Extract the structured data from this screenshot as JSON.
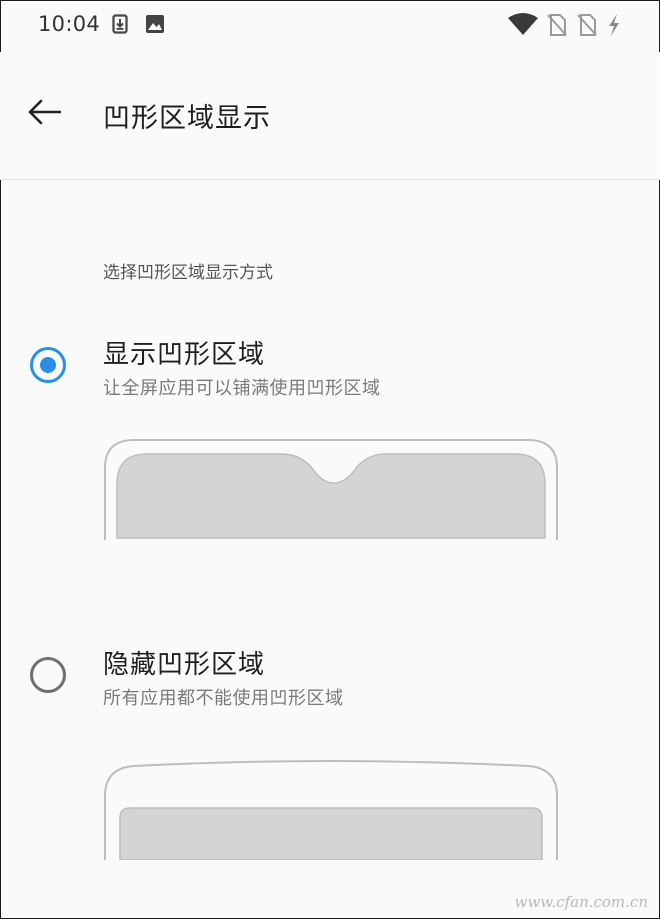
{
  "status_bar": {
    "time": "10:04",
    "left_icons": [
      "download-icon",
      "image-icon"
    ],
    "right_icons": [
      "wifi-icon",
      "no-sim-icon",
      "no-sim-icon",
      "charging-icon"
    ]
  },
  "app_bar": {
    "back_icon": "arrow-left-icon",
    "title": "凹形区域显示"
  },
  "section_label": "选择凹形区域显示方式",
  "options": [
    {
      "title": "显示凹形区域",
      "subtitle": "让全屏应用可以铺满使用凹形区域",
      "checked": true
    },
    {
      "title": "隐藏凹形区域",
      "subtitle": "所有应用都不能使用凹形区域",
      "checked": false
    }
  ],
  "colors": {
    "accent": "#2a8ee8",
    "preview_fill": "#d4d4d4",
    "preview_outline": "#bdbdbd"
  },
  "watermark": "www.cfan.com.cn"
}
